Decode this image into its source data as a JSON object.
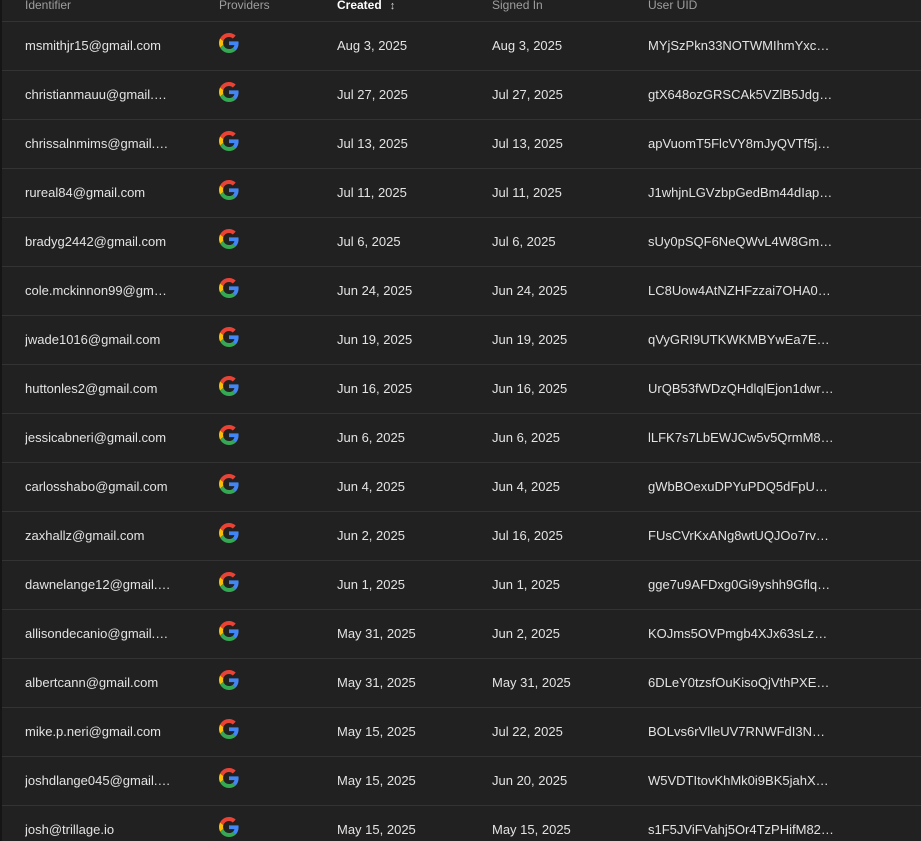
{
  "header": {
    "identifier": "Identifier",
    "providers": "Providers",
    "created": "Created",
    "signed_in": "Signed In",
    "user_uid": "User UID"
  },
  "rows": [
    {
      "identifier": "msmithjr15@gmail.com",
      "provider": "google-icon",
      "created": "Aug 3, 2025",
      "signed_in": "Aug 3, 2025",
      "uid": "MYjSzPkn33NOTWMIhmYxc9…"
    },
    {
      "identifier": "christianmauu@gmail.c…",
      "provider": "google-icon",
      "created": "Jul 27, 2025",
      "signed_in": "Jul 27, 2025",
      "uid": "gtX648ozGRSCAk5VZlB5Jdglx…"
    },
    {
      "identifier": "chrissalnmims@gmail.…",
      "provider": "google-icon",
      "created": "Jul 13, 2025",
      "signed_in": "Jul 13, 2025",
      "uid": "apVuomT5FlcVY8mJyQVTf5je…"
    },
    {
      "identifier": "rureal84@gmail.com",
      "provider": "google-icon",
      "created": "Jul 11, 2025",
      "signed_in": "Jul 11, 2025",
      "uid": "J1whjnLGVzbpGedBm44dIap…"
    },
    {
      "identifier": "bradyg2442@gmail.com",
      "provider": "google-icon",
      "created": "Jul 6, 2025",
      "signed_in": "Jul 6, 2025",
      "uid": "sUy0pSQF6NeQWvL4W8Gmr…"
    },
    {
      "identifier": "cole.mckinnon99@gma…",
      "provider": "google-icon",
      "created": "Jun 24, 2025",
      "signed_in": "Jun 24, 2025",
      "uid": "LC8Uow4AtNZHFzzai7OHA0h…"
    },
    {
      "identifier": "jwade1016@gmail.com",
      "provider": "google-icon",
      "created": "Jun 19, 2025",
      "signed_in": "Jun 19, 2025",
      "uid": "qVyGRI9UTKWKMBYwEa7E3g…"
    },
    {
      "identifier": "huttonles2@gmail.com",
      "provider": "google-icon",
      "created": "Jun 16, 2025",
      "signed_in": "Jun 16, 2025",
      "uid": "UrQB53fWDzQHdlqlEjon1dwrZ…"
    },
    {
      "identifier": "jessicabneri@gmail.com",
      "provider": "google-icon",
      "created": "Jun 6, 2025",
      "signed_in": "Jun 6, 2025",
      "uid": "lLFK7s7LbEWJCw5v5QrmM8…"
    },
    {
      "identifier": "carlosshabo@gmail.com",
      "provider": "google-icon",
      "created": "Jun 4, 2025",
      "signed_in": "Jun 4, 2025",
      "uid": "gWbBOexuDPYuPDQ5dFpUGa…"
    },
    {
      "identifier": "zaxhallz@gmail.com",
      "provider": "google-icon",
      "created": "Jun 2, 2025",
      "signed_in": "Jul 16, 2025",
      "uid": "FUsCVrKxANg8wtUQJOo7rvb…"
    },
    {
      "identifier": "dawnelange12@gmail.…",
      "provider": "google-icon",
      "created": "Jun 1, 2025",
      "signed_in": "Jun 1, 2025",
      "uid": "gge7u9AFDxg0Gi9yshh9Gflq7…"
    },
    {
      "identifier": "allisondecanio@gmail.c…",
      "provider": "google-icon",
      "created": "May 31, 2025",
      "signed_in": "Jun 2, 2025",
      "uid": "KOJms5OVPmgb4XJx63sLzm…"
    },
    {
      "identifier": "albertcann@gmail.com",
      "provider": "google-icon",
      "created": "May 31, 2025",
      "signed_in": "May 31, 2025",
      "uid": "6DLeY0tzsfOuKisoQjVthPXEm…"
    },
    {
      "identifier": "mike.p.neri@gmail.com",
      "provider": "google-icon",
      "created": "May 15, 2025",
      "signed_in": "Jul 22, 2025",
      "uid": "BOLvs6rVlleUV7RNWFdI3NW…"
    },
    {
      "identifier": "joshdlange045@gmail.…",
      "provider": "google-icon",
      "created": "May 15, 2025",
      "signed_in": "Jun 20, 2025",
      "uid": "W5VDTItovKhMk0i9BK5jahX0t…"
    },
    {
      "identifier": "josh@trillage.io",
      "provider": "google-icon",
      "created": "May 15, 2025",
      "signed_in": "May 15, 2025",
      "uid": "s1F5JViFVahj5Or4TzPHifM82…"
    }
  ],
  "colors": {
    "background": "#212121",
    "divider": "#333333",
    "text": "#e3e3e3",
    "header_text": "#9e9e9e",
    "google_blue": "#4285F4",
    "google_red": "#EA4335",
    "google_yellow": "#FBBC05",
    "google_green": "#34A853"
  }
}
